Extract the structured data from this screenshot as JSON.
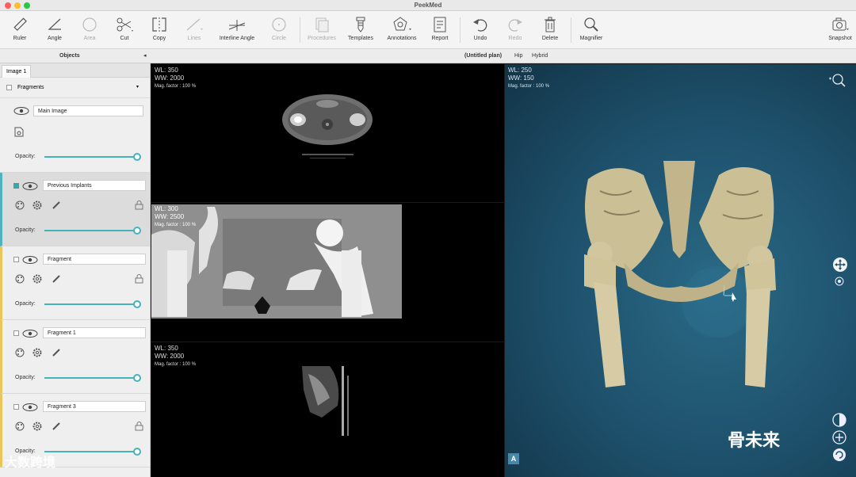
{
  "window": {
    "title": "PeekMed"
  },
  "toolbar": {
    "tools": [
      {
        "id": "ruler",
        "label": "Ruler",
        "enabled": true
      },
      {
        "id": "angle",
        "label": "Angle",
        "enabled": true
      },
      {
        "id": "area",
        "label": "Area",
        "enabled": false
      },
      {
        "id": "cut",
        "label": "Cut",
        "enabled": true
      },
      {
        "id": "copy",
        "label": "Copy",
        "enabled": true
      },
      {
        "id": "lines",
        "label": "Lines",
        "enabled": false
      },
      {
        "id": "interline",
        "label": "Interline Angle",
        "enabled": true
      },
      {
        "id": "circle",
        "label": "Circle",
        "enabled": false
      },
      {
        "id": "procedures",
        "label": "Procedures",
        "enabled": false
      },
      {
        "id": "templates",
        "label": "Templates",
        "enabled": true
      },
      {
        "id": "annotations",
        "label": "Annotations",
        "enabled": true
      },
      {
        "id": "report",
        "label": "Report",
        "enabled": true
      },
      {
        "id": "undo",
        "label": "Undo",
        "enabled": true
      },
      {
        "id": "redo",
        "label": "Redo",
        "enabled": false
      },
      {
        "id": "delete",
        "label": "Delete",
        "enabled": true
      },
      {
        "id": "magnifier",
        "label": "Magnifier",
        "enabled": true
      },
      {
        "id": "snapshot",
        "label": "Snapshot",
        "enabled": true
      }
    ]
  },
  "panel_bar": {
    "objects_label": "Objects",
    "plan_label": "(Untitled plan)",
    "hip_label": "Hip",
    "hybrid_label": "Hybrid"
  },
  "sidebar": {
    "tab": "Image 1",
    "fragments_header": "Fragments",
    "items": [
      {
        "name": "Main Image",
        "opacity_label": "Opacity:",
        "opacity": 1.0
      },
      {
        "name": "Previous Implants",
        "opacity_label": "Opacity:",
        "opacity": 1.0
      },
      {
        "name": "Fragment",
        "opacity_label": "Opacity:",
        "opacity": 1.0
      },
      {
        "name": "Fragment 1",
        "opacity_label": "Opacity:",
        "opacity": 1.0
      },
      {
        "name": "Fragment 3",
        "opacity_label": "Opacity:",
        "opacity": 1.0
      }
    ]
  },
  "viewports": [
    {
      "wl": "WL: 350",
      "ww": "WW: 2000",
      "mag": "Mag. factor : 100 %"
    },
    {
      "wl": "WL: 300",
      "ww": "WW: 2500",
      "mag": "Mag. factor : 100 %"
    },
    {
      "wl": "WL: 350",
      "ww": "WW: 2000",
      "mag": "Mag. factor : 100 %"
    },
    {
      "wl": "WL: 250",
      "ww": "WW: 150",
      "mag": "Mag. factor : 100 %"
    }
  ],
  "view3d": {
    "orientation_badge": "A"
  },
  "watermarks": {
    "left": "大数跨境",
    "right": "骨未来"
  },
  "colors": {
    "accent": "#45b3b8",
    "fragment_marker": "#e9c55a",
    "view3d_bg": "#1d4f6a"
  }
}
